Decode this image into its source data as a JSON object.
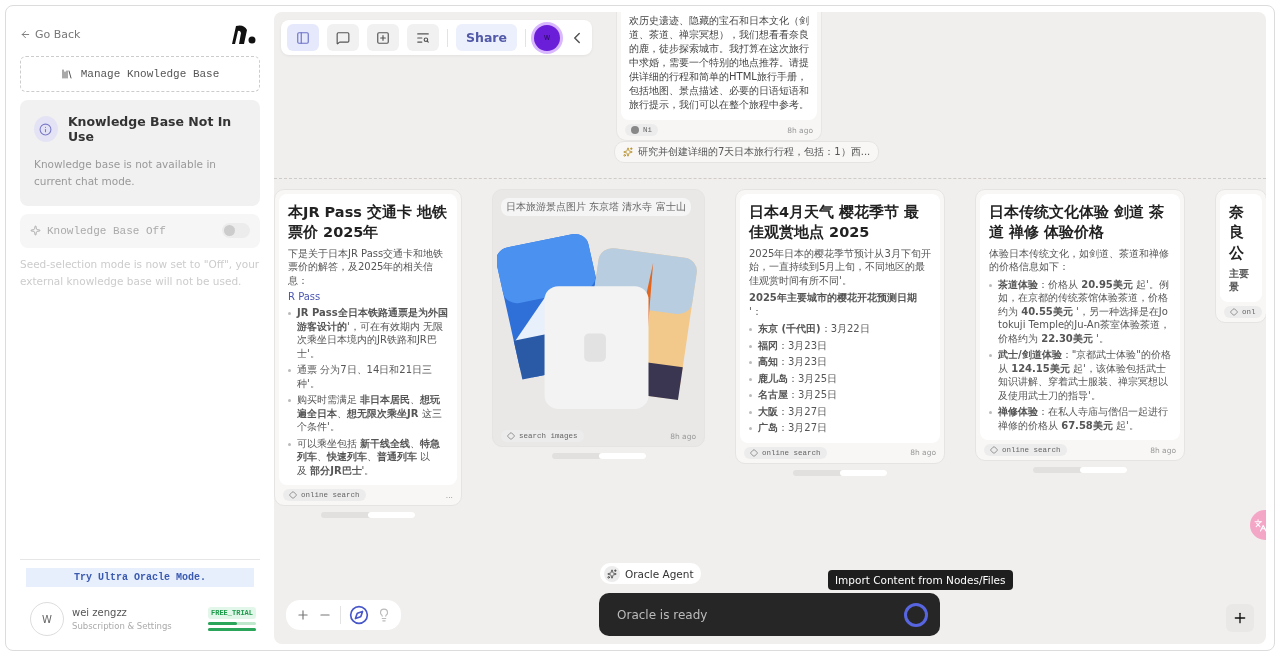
{
  "sidebar": {
    "back": "Go Back",
    "manage_button": "Manage Knowledge Base",
    "notice": {
      "title": "Knowledge Base Not In Use",
      "text": "Knowledge base is not available in current chat mode."
    },
    "toggle": {
      "label": "Knowledge Base Off",
      "on": false
    },
    "hint": "Seed-selection mode is now set to \"Off\", your external knowledge base will not be used.",
    "upgrade": "Try Ultra Oracle Mode.",
    "user": {
      "initial": "W",
      "name": "wei zengzz",
      "subtitle": "Subscription & Settings",
      "plan": "FREE_TRIAL",
      "usage": [
        {
          "level": 0.6
        },
        {
          "level": 1
        }
      ]
    }
  },
  "toolbar": {
    "buttons": [
      {
        "kind": "sidebar",
        "selected": true
      },
      {
        "kind": "chat",
        "selected": false
      },
      {
        "kind": "add",
        "selected": false
      },
      {
        "kind": "search",
        "selected": false
      }
    ],
    "share": "Share",
    "avatar": "w"
  },
  "canvas": {
    "message": {
      "text": "欢历史遗迹、隐藏的宝石和日本文化（剑道、茶道、禅宗冥想），我们想看看奈良的鹿，徒步探索城市。我打算在这次旅行中求婚，需要一个特别的地点推荐。请提供详细的行程和简单的HTML旅行手册，包括地图、景点描述、必要的日语短语和旅行提示，我们可以在整个旅程中参考。",
      "author": "Ni",
      "time": "8h ago"
    },
    "prompt": "研究并创建详细的7天日本旅行行程，包括：1）西...",
    "cards": [
      {
        "kind": "text",
        "title": "本JR Pass 交通卡 地铁票价 2025年",
        "blocks": [
          {
            "kind": "p",
            "text": "下是关于日本JR Pass交通卡和地铁票价的解答，及2025年的相关信息："
          },
          {
            "kind": "sub",
            "text": "R Pass"
          },
          {
            "kind": "list",
            "items": [
              "**JR Pass全日本铁路通票是为外国游客设计的**'，可在有效期内 无限次乘坐日本境内的JR铁路和JR巴士'。",
              "通票 分为7日、14日和21日三种'。",
              "购买时需满足 **非日本居民**、**想玩遍全日本**、**想无限次乘坐JR** 这三个条件'。",
              "可以乘坐包括 **新干线全线**、**特急列车**、**快速列车**、**普通列车** 以及 **部分JR巴士**'。"
            ]
          }
        ],
        "source": "online search",
        "time": "..."
      },
      {
        "kind": "images",
        "caption": "日本旅游景点图片 东京塔 清水寺 富士山",
        "source": "search images",
        "time": "8h ago"
      },
      {
        "kind": "text",
        "title": "日本4月天气 樱花季节 最佳观赏地点 2025",
        "blocks": [
          {
            "kind": "p",
            "text": "2025年日本的樱花季节预计从3月下旬开始，一直持续到5月上旬，不同地区的最佳观赏时间有所不同'。"
          },
          {
            "kind": "p",
            "text": "**2025年主要城市的樱花开花预测日期** '："
          },
          {
            "kind": "list",
            "items": [
              "**东京 (千代田)**：3月22日",
              "**福冈**：3月23日",
              "**高知**：3月23日",
              "**鹿儿岛**：3月25日",
              "**名古屋**：3月25日",
              "**大阪**：3月27日",
              "**广岛**：3月27日"
            ]
          }
        ],
        "source": "online search",
        "time": "8h ago"
      },
      {
        "kind": "text",
        "title": "日本传统文化体验 剑道 茶道 禅修 体验价格",
        "blocks": [
          {
            "kind": "p",
            "text": "体验日本传统文化，如剑道、茶道和禅修的价格信息如下："
          },
          {
            "kind": "list",
            "items": [
              "**茶道体验**：价格从 **20.95美元** 起'。例如，在京都的传统茶馆体验茶道，价格约为 **40.55美元** '，另一种选择是在Jotokuji Temple的Ju-An茶室体验茶道，价格约为 **22.30美元** '。",
              "**武士/剑道体验**：\"京都武士体验\"的价格从 **124.15美元** 起'，该体验包括武士知识讲解、穿着武士服装、禅宗冥想以及使用武士刀的指导'。",
              "**禅修体验**：在私人寺庙与僧侣一起进行禅修的价格从 **67.58美元** 起'。"
            ]
          }
        ],
        "source": "online search",
        "time": "8h ago"
      },
      {
        "kind": "text",
        "title": "奈良公",
        "blocks": [
          {
            "kind": "p",
            "text": "**主要景**"
          }
        ],
        "source": "onl"
      }
    ]
  },
  "agent": {
    "label": "Oracle Agent"
  },
  "input": {
    "placeholder": "Oracle is ready"
  },
  "tooltip": "Import Content from Nodes/Files"
}
